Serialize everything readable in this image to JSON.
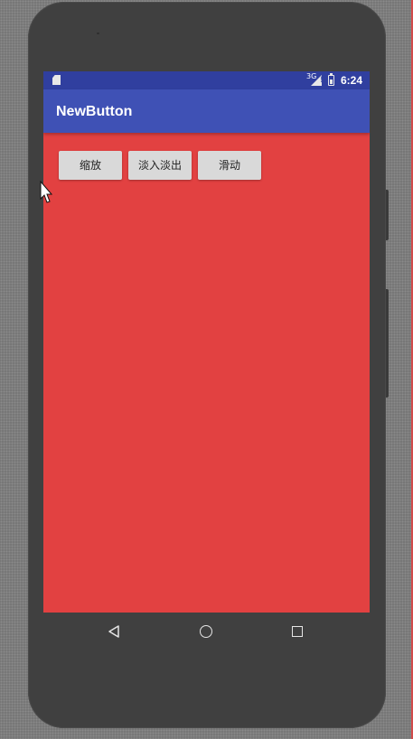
{
  "status_bar": {
    "network": "3G",
    "time": "6:24"
  },
  "app_bar": {
    "title": "NewButton"
  },
  "buttons": [
    {
      "label": "缩放"
    },
    {
      "label": "淡入淡出"
    },
    {
      "label": "滑动"
    }
  ],
  "icons": {
    "sd_card": "sd-card-icon",
    "signal": "cell-signal-icon",
    "battery": "battery-charging-icon",
    "back": "nav-back-icon",
    "home": "nav-home-icon",
    "recents": "nav-recents-icon",
    "cursor": "mouse-cursor-icon"
  },
  "colors": {
    "status_bar": "#303f9f",
    "app_bar": "#3f51b5",
    "content_background": "#e24141",
    "button": "#d9d9d9",
    "device_frame": "#404040"
  }
}
